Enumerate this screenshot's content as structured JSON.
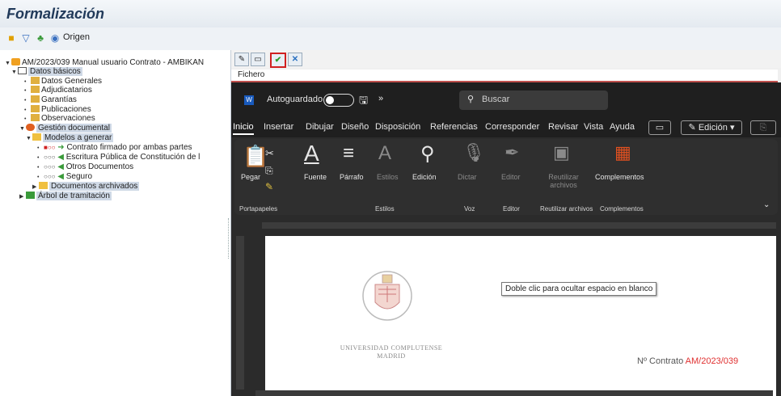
{
  "app": {
    "title": "Formalización",
    "toolbar": {
      "origen_label": "Origen"
    }
  },
  "tree": {
    "root_label": "AM/2023/039 Manual usuario Contrato - AMBIKAN",
    "datos_basicos": "Datos básicos",
    "datos_items": [
      "Datos Generales",
      "Adjudicatarios",
      "Garantías",
      "Publicaciones",
      "Observaciones"
    ],
    "gestion": "Gestión documental",
    "modelos": "Modelos a generar",
    "modelos_items": [
      "Contrato firmado por ambas partes",
      "Escritura Pública de Constitución de l",
      "Otros Documentos",
      "Seguro"
    ],
    "documentos": "Documentos archivados",
    "arbol": "Árbol de tramitación"
  },
  "doc_pane": {
    "fichero": "Fichero",
    "autosave_label": "Autoguardado",
    "more": "»",
    "search_placeholder": "Buscar",
    "tabs": [
      "Inicio",
      "Insertar",
      "Dibujar",
      "Diseño",
      "Disposición",
      "Referencias",
      "Corresponder",
      "Revisar",
      "Vista",
      "Ayuda"
    ],
    "edicion_pill": "Edición",
    "ribbon": {
      "pegar": "Pegar",
      "fuente": "Fuente",
      "parrafo": "Párrafo",
      "estilos": "Estilos",
      "edicion": "Edición",
      "dictar": "Dictar",
      "editor": "Editor",
      "reutilizar": "Reutilizar archivos",
      "complementos": "Complementos"
    },
    "groups": {
      "portapapeles": "Portapapeles",
      "estilos": "Estilos",
      "voz": "Voz",
      "editor": "Editor",
      "reutilizar": "Reutilizar archivos",
      "complementos": "Complementos"
    },
    "tooltip": "Doble clic para ocultar espacio en blanco",
    "university_line1": "UNIVERSIDAD COMPLUTENSE",
    "university_line2": "MADRID",
    "contract_prefix": "Nº Contrato",
    "contract_number": "AM/2023/039"
  },
  "colors": {
    "accent_red": "#e03030",
    "selected": "#cfd9e6",
    "word_dark": "#2b2b2b"
  }
}
